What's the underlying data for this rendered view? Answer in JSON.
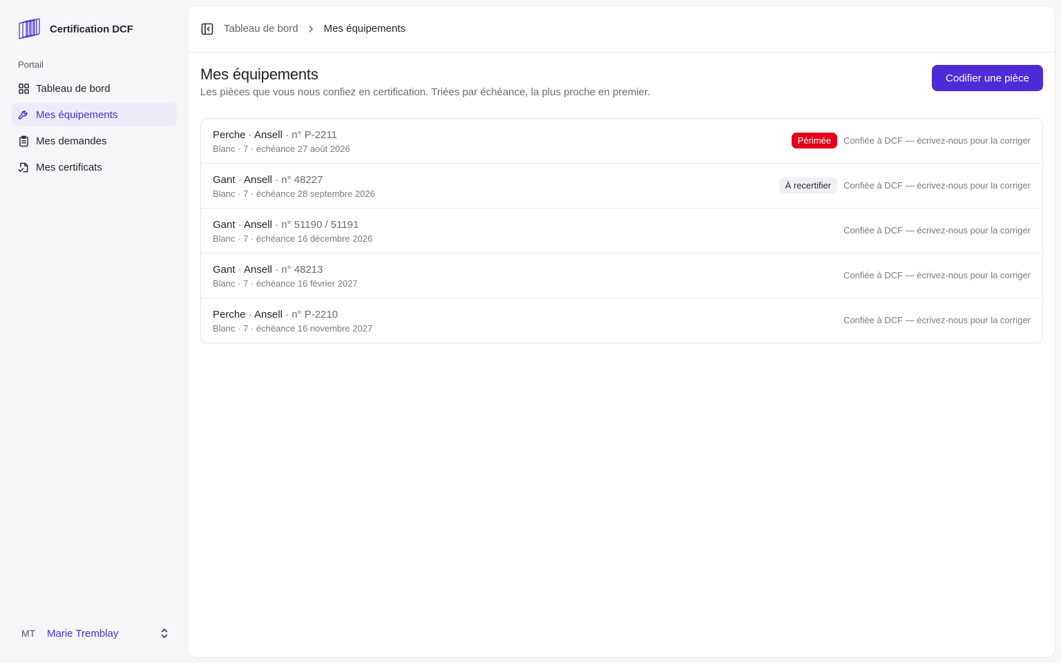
{
  "brand": {
    "name": "Certification DCF"
  },
  "sidebar": {
    "section_label": "Portail",
    "items": [
      {
        "label": "Tableau de bord",
        "icon": "grid-icon",
        "active": false
      },
      {
        "label": "Mes équipements",
        "icon": "wrench-icon",
        "active": true
      },
      {
        "label": "Mes demandes",
        "icon": "clipboard-icon",
        "active": false
      },
      {
        "label": "Mes certificats",
        "icon": "file-certificate-icon",
        "active": false
      }
    ],
    "user": {
      "initials": "MT",
      "name": "Marie Tremblay"
    }
  },
  "breadcrumb": {
    "parent": "Tableau de bord",
    "current": "Mes équipements"
  },
  "page": {
    "title": "Mes équipements",
    "subtitle": "Les pièces que vous nous confiez en certification. Triées par échéance, la plus proche en premier.",
    "primary_button": "Codifier une pièce"
  },
  "equipment": [
    {
      "type": "Perche",
      "brand": "Ansell",
      "serial": "n° P-2211",
      "meta": "Blanc · 7 · échéance 27 août 2026",
      "badge": "Périmée",
      "badge_style": "danger",
      "note": "Confiée à DCF — écrivez-nous pour la corriger"
    },
    {
      "type": "Gant",
      "brand": "Ansell",
      "serial": "n° 48227",
      "meta": "Blanc · 7 · échéance 28 septembre 2026",
      "badge": "À recertifier",
      "badge_style": "neutral",
      "note": "Confiée à DCF — écrivez-nous pour la corriger"
    },
    {
      "type": "Gant",
      "brand": "Ansell",
      "serial": "n° 51190 / 51191",
      "meta": "Blanc · 7 · échéance 16 décembre 2026",
      "badge": "",
      "badge_style": "",
      "note": "Confiée à DCF — écrivez-nous pour la corriger"
    },
    {
      "type": "Gant",
      "brand": "Ansell",
      "serial": "n° 48213",
      "meta": "Blanc · 7 · échéance 16 février 2027",
      "badge": "",
      "badge_style": "",
      "note": "Confiée à DCF — écrivez-nous pour la corriger"
    },
    {
      "type": "Perche",
      "brand": "Ansell",
      "serial": "n° P-2210",
      "meta": "Blanc · 7 · échéance 16 novembre 2027",
      "badge": "",
      "badge_style": "",
      "note": "Confiée à DCF — écrivez-nous pour la corriger"
    }
  ],
  "colors": {
    "accent": "#4e2bd8",
    "accent_text": "#4b2fd0",
    "active_nav_bg": "#ececf8",
    "danger": "#e3001b",
    "neutral_badge_bg": "#f0f0f4",
    "app_bg": "#f6f6f9"
  }
}
